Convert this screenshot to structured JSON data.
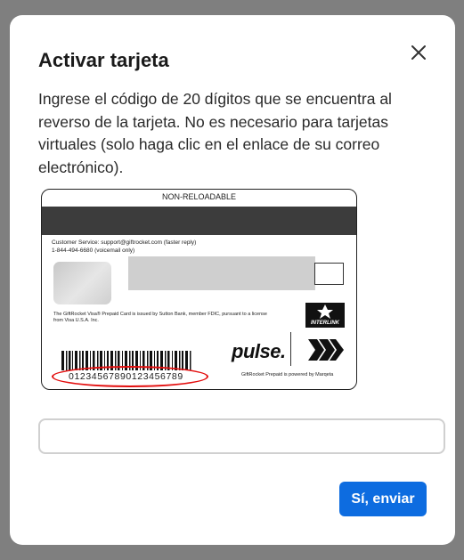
{
  "modal": {
    "title": "Activar tarjeta",
    "description": "Ingrese el código de 20 dígitos que se encuentra al reverso de la tarjeta. No es necesario para tarjetas virtuales (solo haga clic en el enlace de su correo electrónico).",
    "close_icon": "close-icon",
    "code_input": {
      "value": "",
      "placeholder": ""
    },
    "submit_label": "Sí, enviar"
  },
  "card": {
    "header": "NON-RELOADABLE",
    "customer_service": "Customer Service: support@giftrocket.com (faster reply)",
    "phone": "1-844-494-6680 (voicemail only)",
    "issued_by": "The GiftRocket Visa® Prepaid Card is issued by Sutton Bank, member FDIC, pursuant to a license from Visa U.S.A. Inc.",
    "interlink_label": "INTERLINK",
    "pulse_label": "pulse.",
    "powered_by": "GiftRocket Prepaid is powered by Marqeta",
    "card_number": "01234567890123456789"
  },
  "colors": {
    "accent": "#0d6ce0",
    "highlight": "#e30e0e",
    "overlay": "#7f7f7f"
  }
}
